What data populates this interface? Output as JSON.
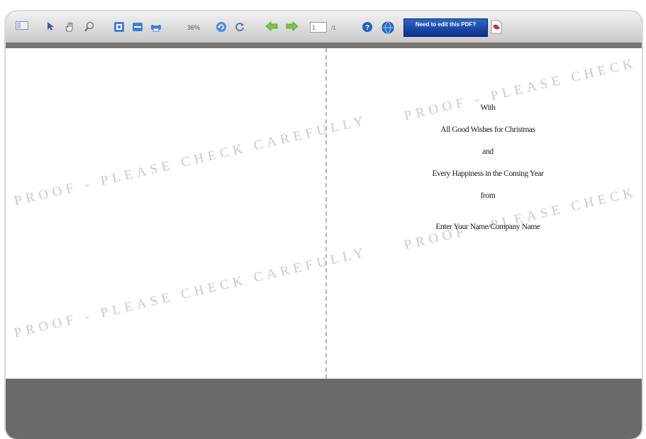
{
  "toolbar": {
    "zoom_label": "36%",
    "page_input_value": "1",
    "page_total": "/1",
    "banner_text": "Need to edit this PDF?"
  },
  "document": {
    "watermark_text": "PROOF - PLEASE CHECK CAREFULLY",
    "card_lines": [
      "With",
      "All Good Wishes for Christmas",
      "and",
      "Every Happiness in the Coming Year",
      "from",
      "Enter Your Name/Company Name"
    ]
  }
}
